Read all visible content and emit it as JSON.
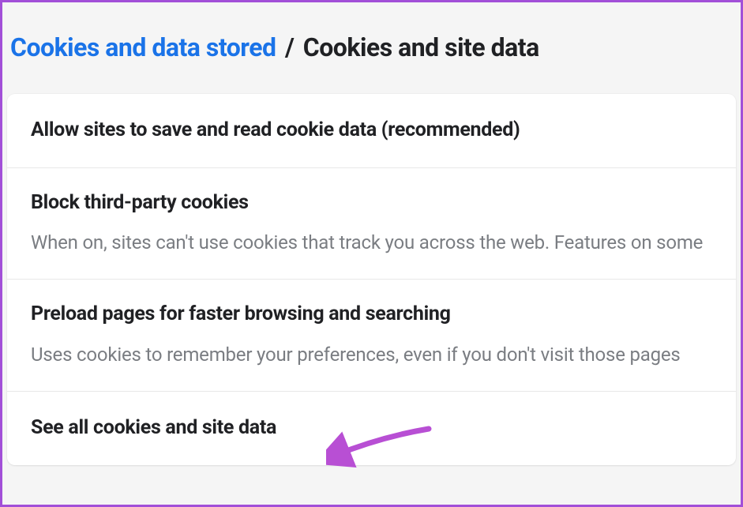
{
  "breadcrumb": {
    "parent": "Cookies and data stored",
    "separator": "/",
    "current": "Cookies and site data"
  },
  "rows": {
    "allow": {
      "title": "Allow sites to save and read cookie data (recommended)"
    },
    "block_third_party": {
      "title": "Block third-party cookies",
      "subtitle": "When on, sites can't use cookies that track you across the web. Features on some"
    },
    "preload": {
      "title": "Preload pages for faster browsing and searching",
      "subtitle": "Uses cookies to remember your preferences, even if you don't visit those pages"
    },
    "see_all": {
      "title": "See all cookies and site data"
    }
  }
}
